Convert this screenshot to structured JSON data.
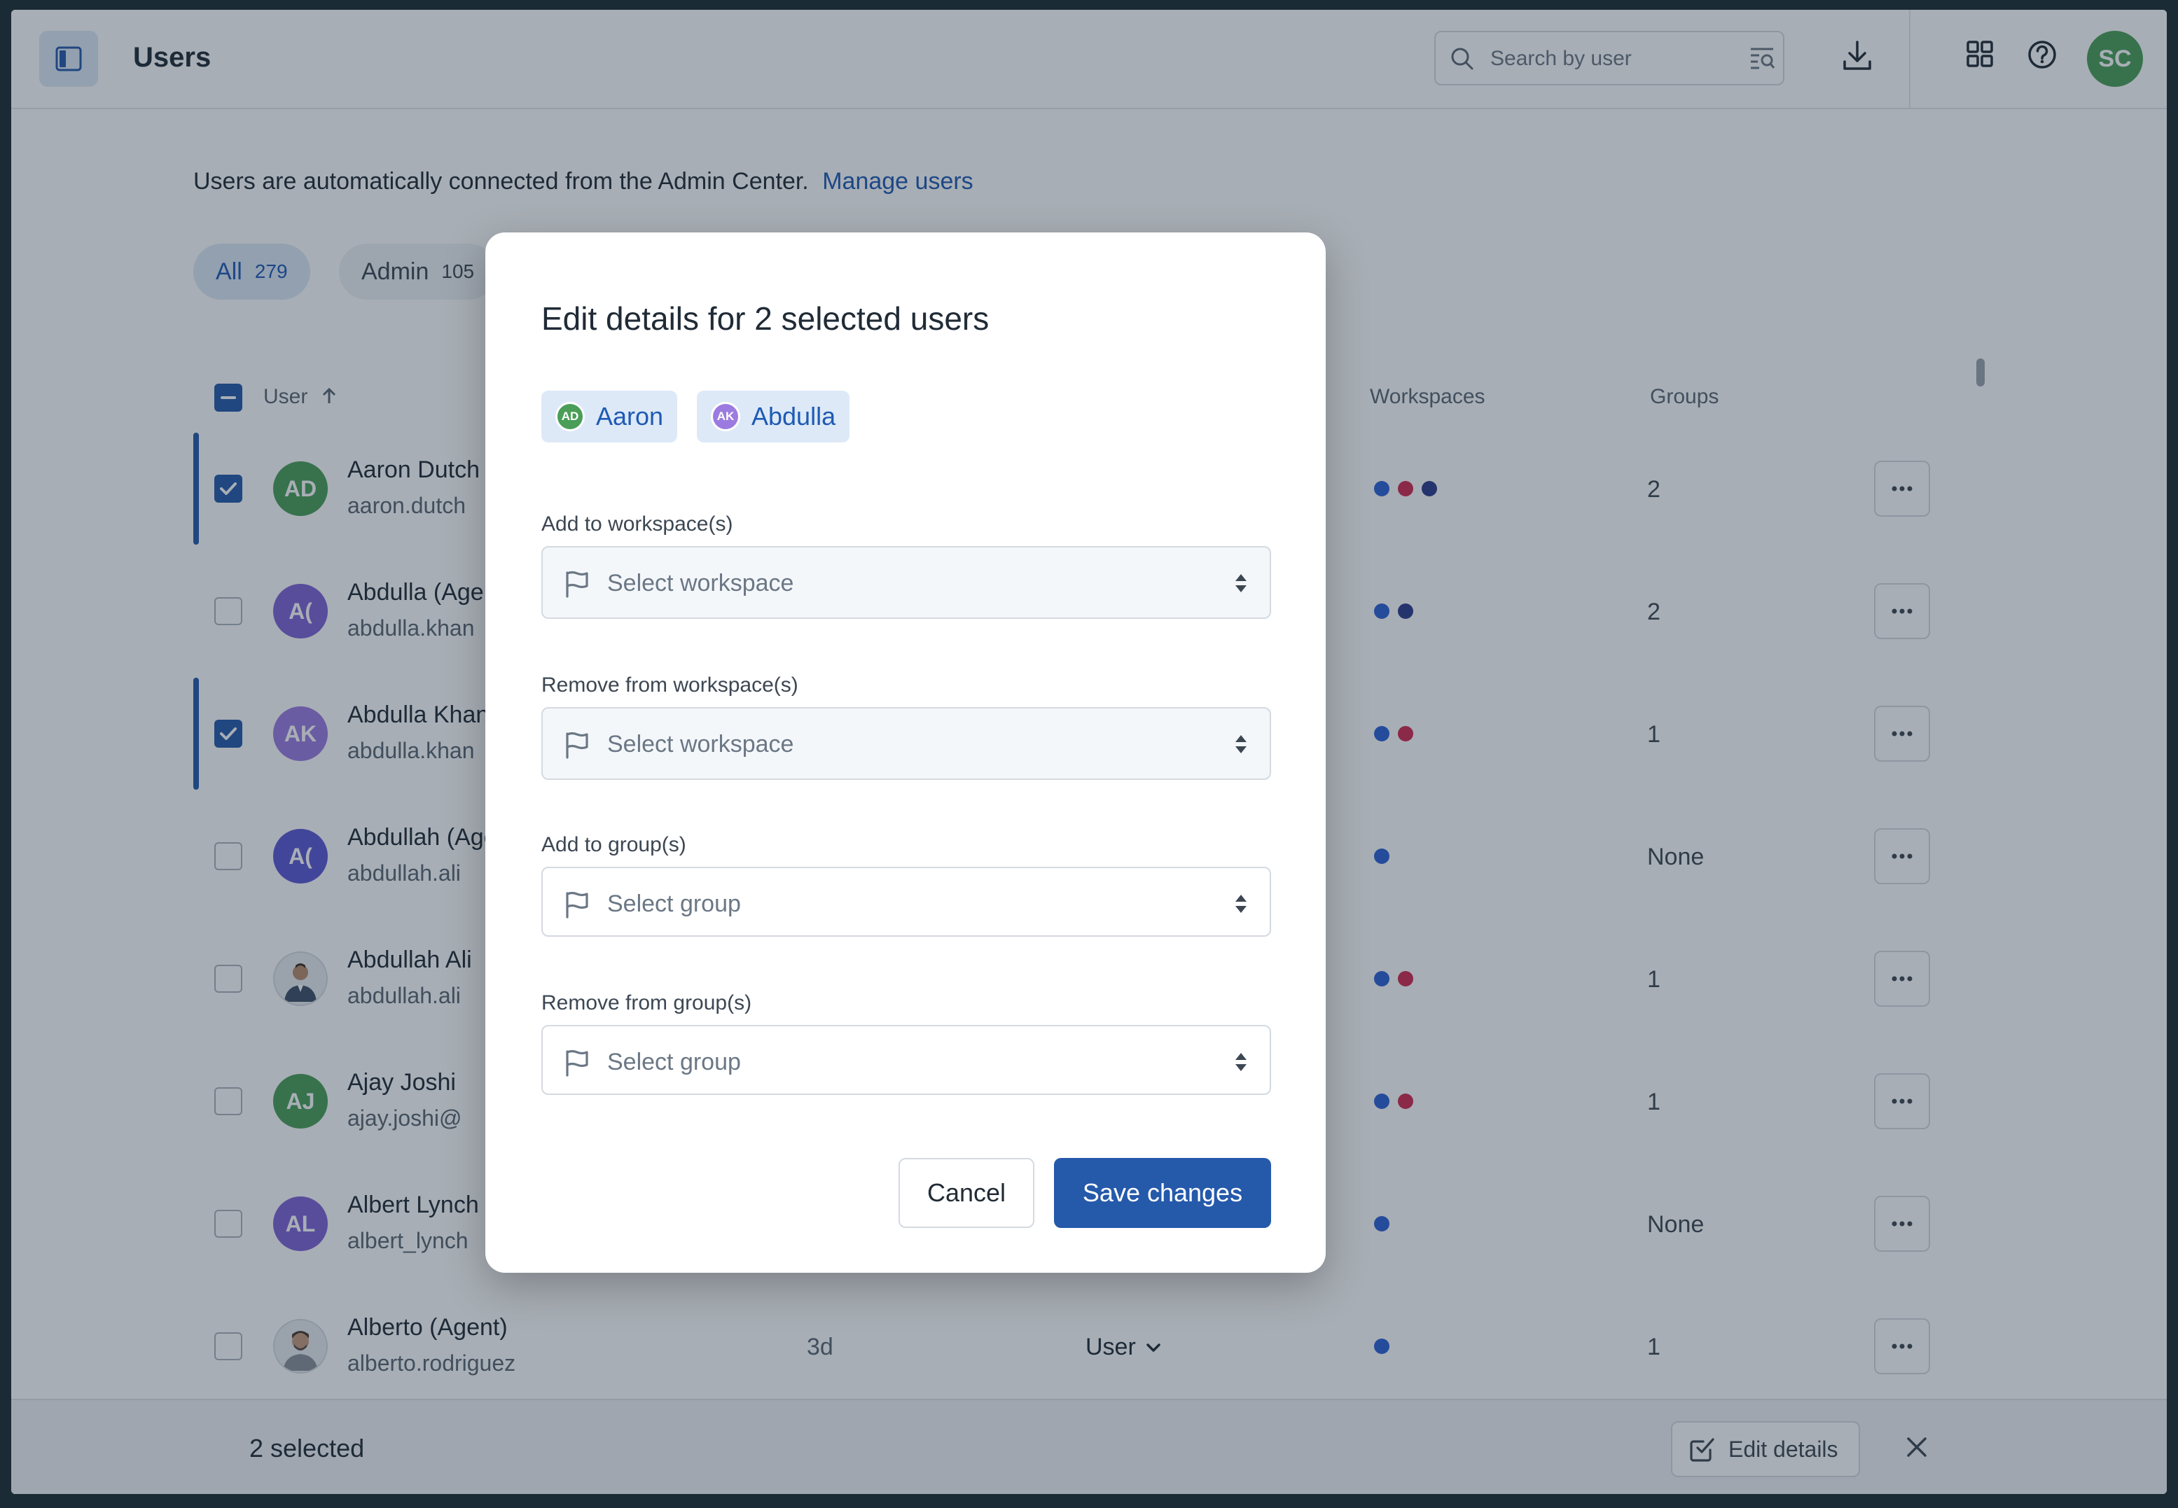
{
  "colors": {
    "accent": "#2559aa",
    "link": "#1e5ab4",
    "avatar_green": "#4a9e57",
    "avatar_purple": "#7f63d6",
    "workspace_blue": "#2c5fd6",
    "workspace_red": "#d0294f",
    "workspace_navy": "#2e3a8c"
  },
  "header": {
    "title": "Users",
    "sidebar_toggle_icon": "sidebar-toggle-icon",
    "search_placeholder": "Search by user",
    "download_icon": "download-icon",
    "apps_icon": "grid-icon",
    "help_icon": "help-icon",
    "user_initials": "SC"
  },
  "main": {
    "info_text": "Users are automatically connected from the Admin Center.",
    "manage_link": "Manage users",
    "filters": [
      {
        "label": "All",
        "count": "279"
      },
      {
        "label": "Admin",
        "count": "105"
      }
    ],
    "columns": {
      "user": "User",
      "workspaces": "Workspaces",
      "groups": "Groups"
    },
    "rows": [
      {
        "initials": "AD",
        "name": "Aaron Dutch",
        "email": "aaron.dutch",
        "checked": true,
        "workspaces": [
          "blue",
          "red",
          "navy"
        ],
        "groups": "2"
      },
      {
        "initials": "A(",
        "name": "Abdulla (Agent)",
        "email": "abdulla.khan",
        "checked": false,
        "workspaces": [
          "blue",
          "navy"
        ],
        "groups": "2"
      },
      {
        "initials": "AK",
        "name": "Abdulla Khan",
        "email": "abdulla.khan",
        "checked": true,
        "workspaces": [
          "blue",
          "red"
        ],
        "groups": "1"
      },
      {
        "initials": "A(",
        "name": "Abdullah (Agent)",
        "email": "abdullah.ali",
        "checked": false,
        "workspaces": [
          "blue"
        ],
        "groups": "None"
      },
      {
        "initials": "",
        "name": "Abdullah Ali",
        "email": "abdullah.ali",
        "checked": false,
        "workspaces": [
          "blue",
          "red"
        ],
        "groups": "1"
      },
      {
        "initials": "AJ",
        "name": "Ajay Joshi",
        "email": "ajay.joshi@",
        "checked": false,
        "workspaces": [
          "blue",
          "red"
        ],
        "groups": "1"
      },
      {
        "initials": "AL",
        "name": "Albert Lynch",
        "email": "albert_lynch",
        "checked": false,
        "workspaces": [
          "blue"
        ],
        "groups": "None"
      },
      {
        "initials": "",
        "name": "Alberto (Agent)",
        "email": "alberto.rodriguez",
        "checked": false,
        "last_active": "3d",
        "role": "User",
        "workspaces": [
          "blue"
        ],
        "groups": "1"
      }
    ]
  },
  "selection_bar": {
    "count_text": "2 selected",
    "edit_label": "Edit details"
  },
  "modal": {
    "title": "Edit details for 2 selected users",
    "chips": [
      {
        "initials": "AD",
        "label": "Aaron"
      },
      {
        "initials": "AK",
        "label": "Abdulla"
      }
    ],
    "fields": [
      {
        "label": "Add to workspace(s)",
        "placeholder": "Select workspace"
      },
      {
        "label": "Remove from workspace(s)",
        "placeholder": "Select workspace"
      },
      {
        "label": "Add to group(s)",
        "placeholder": "Select group"
      },
      {
        "label": "Remove from group(s)",
        "placeholder": "Select group"
      }
    ],
    "cancel_label": "Cancel",
    "save_label": "Save changes"
  }
}
